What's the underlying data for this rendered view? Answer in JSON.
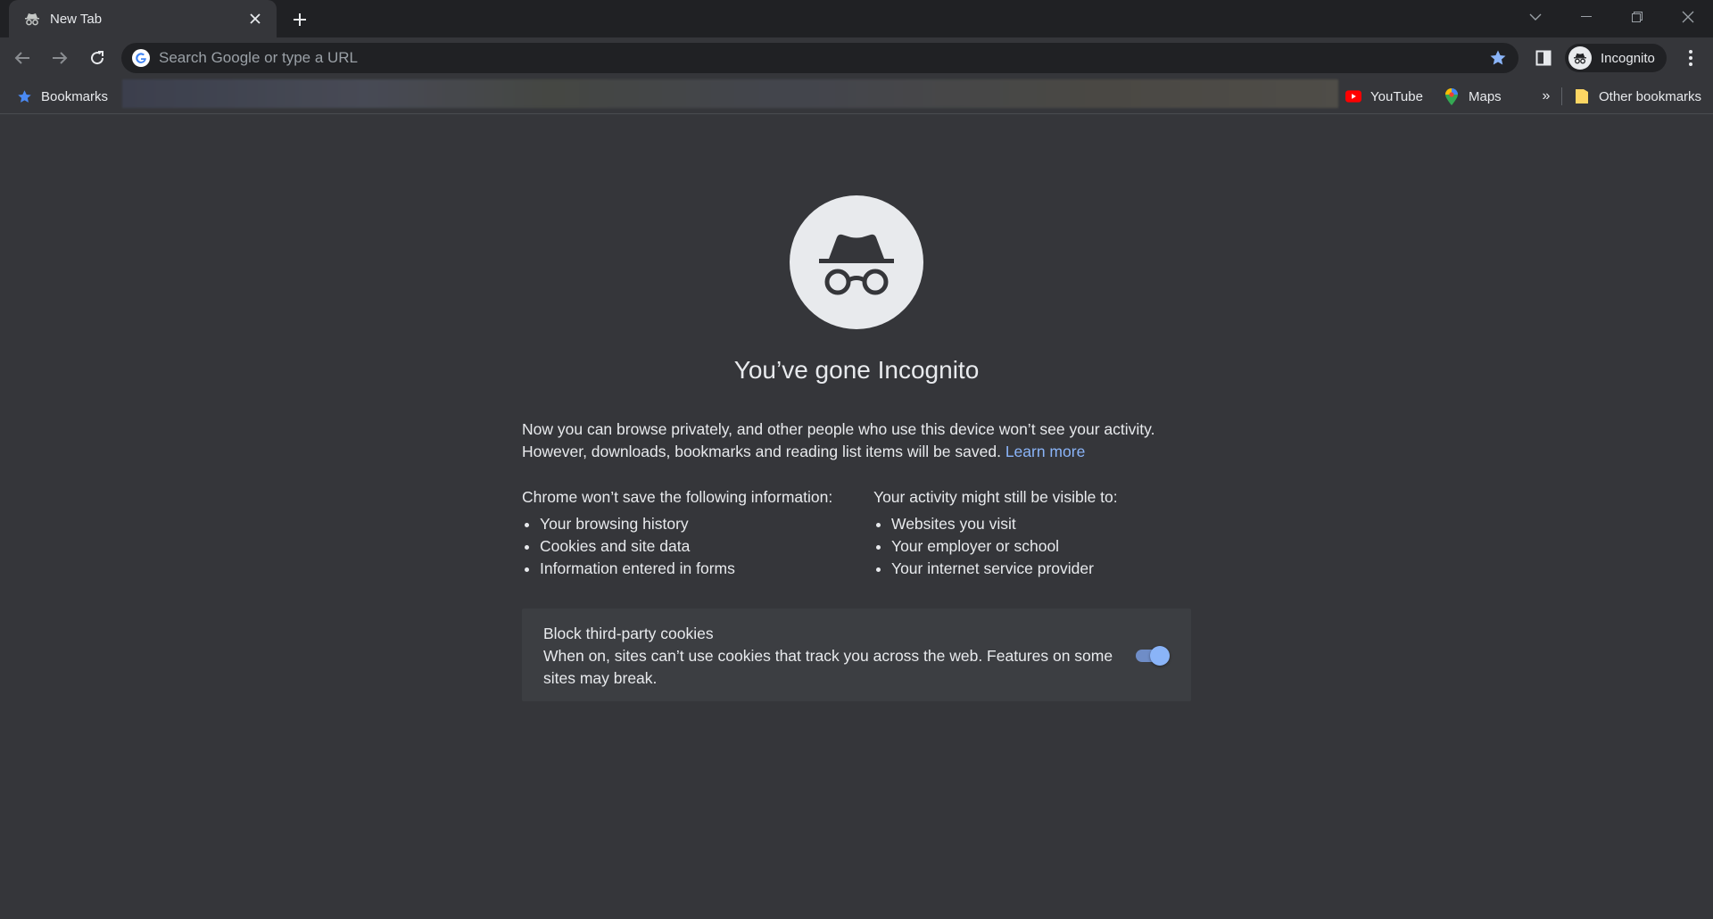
{
  "tab": {
    "title": "New Tab",
    "icon": "incognito-icon"
  },
  "omnibox": {
    "placeholder": "Search Google or type a URL"
  },
  "profile": {
    "label": "Incognito"
  },
  "bookmarks": {
    "folder_label": "Bookmarks",
    "youtube_label": "YouTube",
    "maps_label": "Maps",
    "more_label": "»",
    "other_label": "Other bookmarks"
  },
  "page": {
    "title": "You’ve gone Incognito",
    "intro_line1": "Now you can browse privately, and other people who use this device won’t see your activity.",
    "intro_line2": "However, downloads, bookmarks and reading list items will be saved.",
    "learn_more": "Learn more",
    "left_heading": "Chrome won’t save the following information:",
    "left_items": [
      "Your browsing history",
      "Cookies and site data",
      "Information entered in forms"
    ],
    "right_heading": "Your activity might still be visible to:",
    "right_items": [
      "Websites you visit",
      "Your employer or school",
      "Your internet service provider"
    ],
    "cookie_title": "Block third-party cookies",
    "cookie_desc": "When on, sites can’t use cookies that track you across the web. Features on some sites may break.",
    "cookie_toggle_on": true
  },
  "colors": {
    "background": "#35363a",
    "tabstrip": "#202124",
    "link": "#8ab4f8",
    "toggle": "#8ab4f8"
  }
}
